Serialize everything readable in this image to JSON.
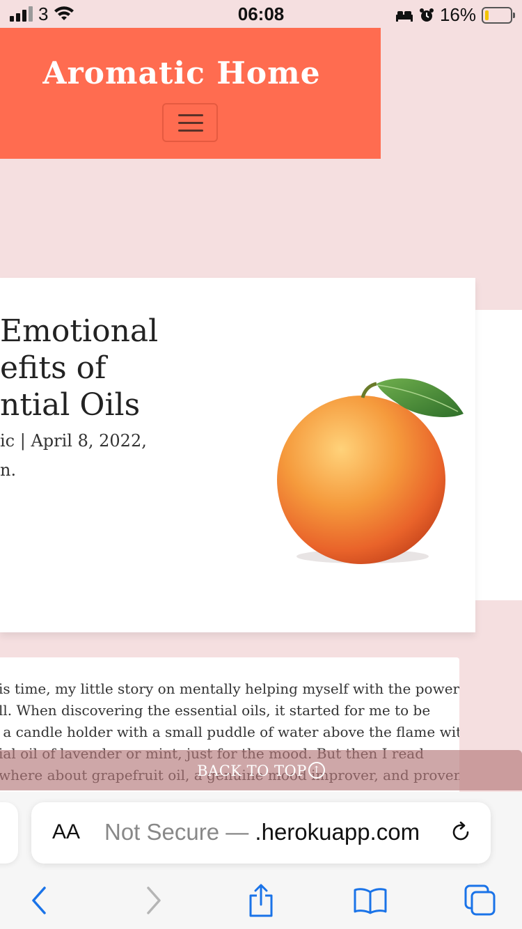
{
  "status_bar": {
    "carrier": "3",
    "time": "06:08",
    "battery": "16%",
    "battery_level": 0.16,
    "icons": [
      "signal-icon",
      "wifi-icon",
      "bed-icon",
      "alarm-icon",
      "battery-icon"
    ]
  },
  "header": {
    "site_title": "Aromatic Home",
    "menu_icon": "hamburger-icon",
    "background": "#ff6c50"
  },
  "post": {
    "title": "Emotional\nefits of\nntial Oils",
    "meta": "ic | April 8, 2022,",
    "meta_continued": "n.",
    "image": "grapefruit-image"
  },
  "article": {
    "text": "is time, my little story on mentally helping myself with the power\nll. When discovering the essential oils, it started for me to be\n a candle holder with a small puddle of water above the flame with\nial oil of lavender or mint, just for the mood. But then I read\nwhere about grapefruit oil, a genuine mood improver, and proven\n                                                                   "
  },
  "back_to_top": {
    "label": "BACK TO TOP",
    "icon": "arrow-up-circle-icon"
  },
  "browser": {
    "aa_label": "AA",
    "url_prefix": "Not Secure — ",
    "url_domain": ".herokuapp.com",
    "icons": [
      "reload-icon",
      "back-icon",
      "forward-icon",
      "share-icon",
      "bookmarks-icon",
      "tabs-icon"
    ],
    "accent": "#1a73e8"
  }
}
